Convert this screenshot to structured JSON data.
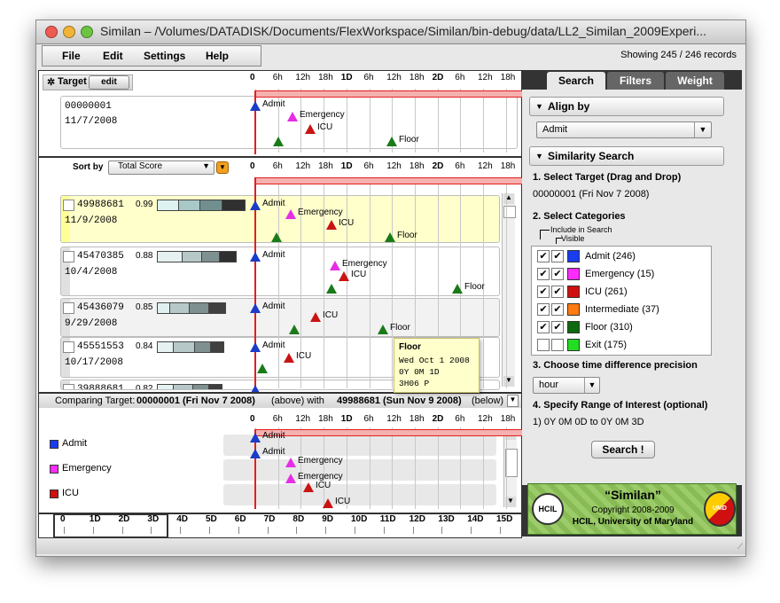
{
  "window": {
    "title": "Similan – /Volumes/DATADISK/Documents/FlexWorkspace/Similan/bin-debug/data/LL2_Similan_2009Experi..."
  },
  "menu": {
    "items": [
      "File",
      "Edit",
      "Settings",
      "Help"
    ]
  },
  "status": {
    "records": "Showing 245  / 246 records"
  },
  "target_panel": {
    "label": "Target",
    "edit": "edit",
    "id": "00000001",
    "date": "11/7/2008"
  },
  "timeline": {
    "ticks": [
      "0",
      "6h",
      "12h",
      "18h",
      "1D",
      "6h",
      "12h",
      "18h",
      "2D",
      "6h",
      "12h",
      "18h",
      "3D",
      "6h",
      "12h"
    ]
  },
  "events": {
    "admit": "Admit",
    "emergency": "Emergency",
    "icu": "ICU",
    "floor": "Floor"
  },
  "sort": {
    "label": "Sort by",
    "value": "Total Score"
  },
  "records": [
    {
      "id": "49988681",
      "score": "0.99",
      "date": "11/9/2008"
    },
    {
      "id": "45470385",
      "score": "0.88",
      "date": "10/4/2008"
    },
    {
      "id": "45436079",
      "score": "0.85",
      "date": "9/29/2008"
    },
    {
      "id": "45551553",
      "score": "0.84",
      "date": "10/17/2008"
    },
    {
      "id": "39888681",
      "score": "0.82",
      "date": ""
    }
  ],
  "tooltip": {
    "title": "Floor",
    "line1": "Wed Oct 1 2008",
    "line2": "0Y 0M 1D",
    "line3": "3H06 P"
  },
  "compare": {
    "prefix": "Comparing Target:",
    "target": "00000001 (Fri Nov 7 2008)",
    "above": "(above)  with",
    "other": "49988681 (Sun Nov 9 2008)",
    "below": "(below)",
    "rows": [
      "Admit",
      "Emergency",
      "ICU"
    ]
  },
  "overview": {
    "ticks": [
      "0",
      "1D",
      "2D",
      "3D",
      "4D",
      "5D",
      "6D",
      "7D",
      "8D",
      "9D",
      "10D",
      "11D",
      "12D",
      "13D",
      "14D",
      "15D"
    ]
  },
  "side": {
    "tabs": [
      "Search",
      "Filters",
      "Weight"
    ],
    "align_title": "Align by",
    "align_value": "Admit",
    "sim_title": "Similarity Search",
    "step1": "1. Select Target (Drag and Drop)",
    "step1_val": "00000001 (Fri Nov 7 2008)",
    "step2": "2. Select Categories",
    "include": "Include in Search",
    "visible": "Visible",
    "categories": [
      {
        "label": "Admit (246)",
        "color": "#1a3cf0",
        "inc": "✔",
        "vis": "✔"
      },
      {
        "label": "Emergency (15)",
        "color": "#ff2bff",
        "inc": "✔",
        "vis": "✔"
      },
      {
        "label": "ICU (261)",
        "color": "#d01010",
        "inc": "✔",
        "vis": "✔"
      },
      {
        "label": "Intermediate (37)",
        "color": "#ff7a10",
        "inc": "✔",
        "vis": "✔"
      },
      {
        "label": "Floor (310)",
        "color": "#0e6a0e",
        "inc": "✔",
        "vis": "✔"
      },
      {
        "label": "Exit (175)",
        "color": "#22dd22",
        "inc": "",
        "vis": ""
      }
    ],
    "step3": "3. Choose time difference precision",
    "precision": "hour",
    "step4": "4. Specify Range of Interest (optional)",
    "range": "1)  0Y 0M 0D  to 0Y 0M 3D",
    "search_btn": "Search !"
  },
  "logo": {
    "title": "“Similan”",
    "copy": "Copyright 2008-2009",
    "org": "HCIL, University of Maryland",
    "left": "HCIL",
    "right": "UMD"
  }
}
